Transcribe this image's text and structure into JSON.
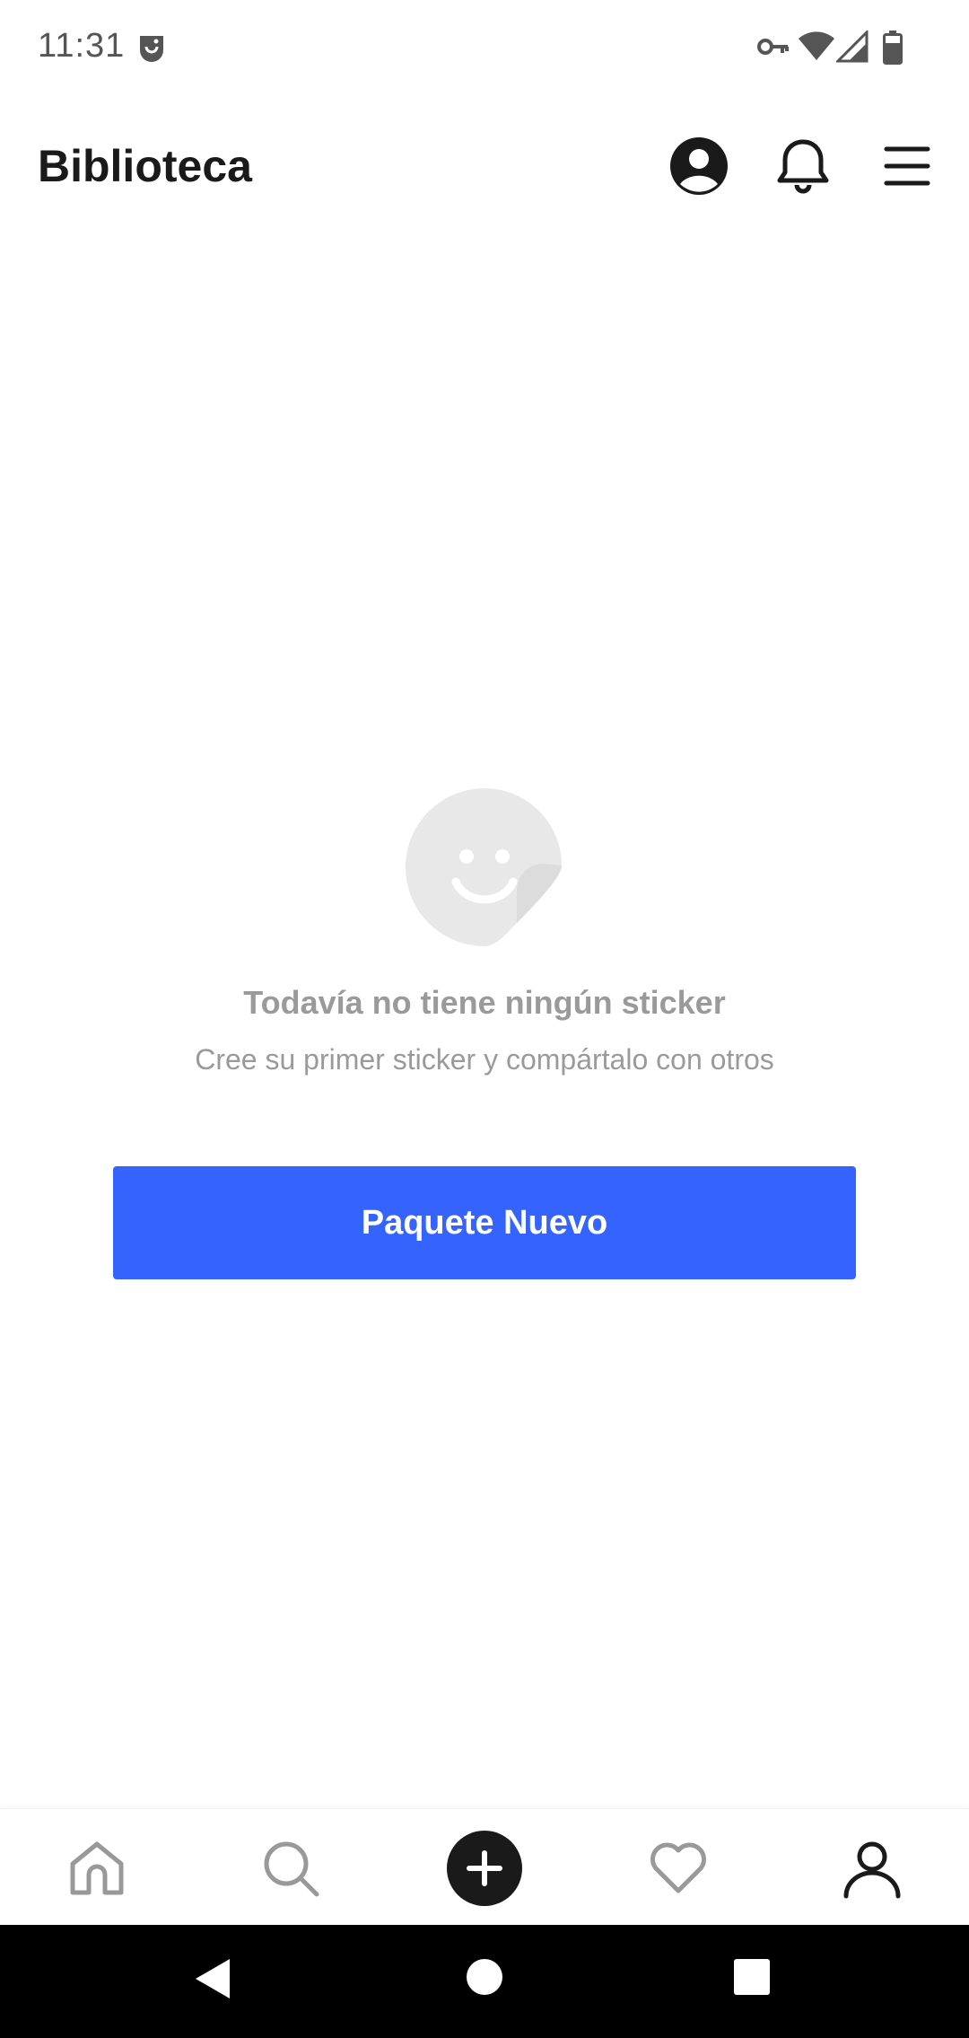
{
  "status_bar": {
    "time": "11:31",
    "icons": [
      "app-notification-icon",
      "vpn-key-icon",
      "wifi-icon",
      "cell-signal-icon",
      "battery-icon"
    ]
  },
  "header": {
    "title": "Biblioteca",
    "icons": [
      "account-circle-icon",
      "bell-icon",
      "hamburger-menu-icon"
    ]
  },
  "empty_state": {
    "icon": "sticker-smiley-icon",
    "title": "Todavía no tiene ningún sticker",
    "subtitle": "Cree su primer sticker y compártalo con otros"
  },
  "actions": {
    "new_pack_label": "Paquete Nuevo"
  },
  "bottom_nav": {
    "items": [
      {
        "icon": "home-icon"
      },
      {
        "icon": "search-icon"
      },
      {
        "icon": "add-circle-icon"
      },
      {
        "icon": "heart-icon"
      },
      {
        "icon": "person-icon"
      }
    ]
  },
  "system_nav": {
    "icons": [
      "back-triangle-icon",
      "home-circle-icon",
      "recents-square-icon"
    ]
  },
  "colors": {
    "primary": "#3563fe",
    "text_dark": "#1a1a1a",
    "text_muted": "#9a9a9a",
    "placeholder": "#e8e8e8"
  }
}
